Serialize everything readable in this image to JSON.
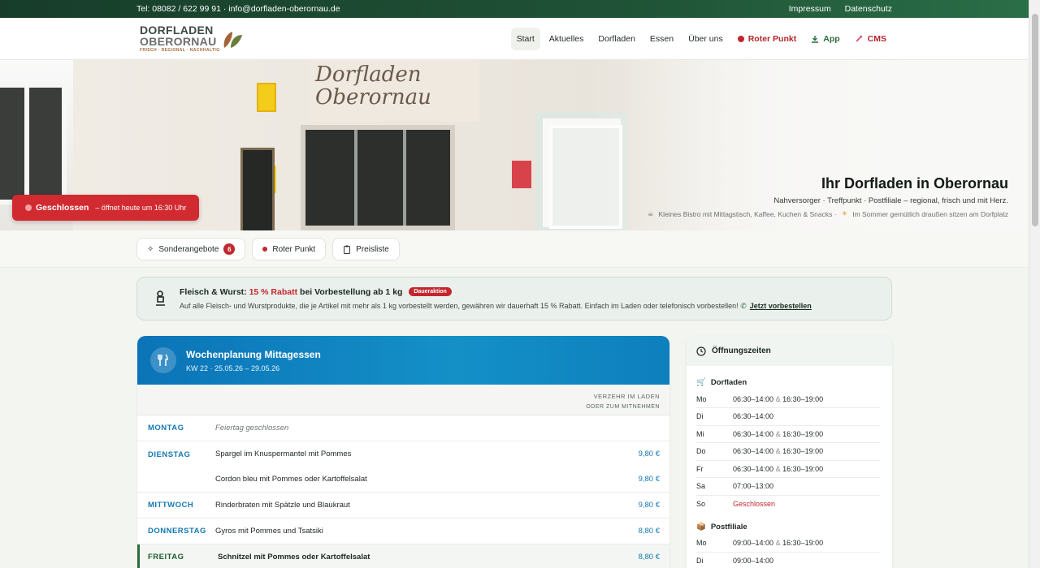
{
  "topbar": {
    "contact": "Tel: 08082 / 622 99 91 · info@dorfladen-oberornau.de",
    "links": [
      "Impressum",
      "Datenschutz"
    ]
  },
  "logo": {
    "line1": "DORFLADEN",
    "line2": "OBERORNAU",
    "tagline": "FRISCH · REGIONAL · NACHHALTIG"
  },
  "nav": {
    "items": [
      "Start",
      "Aktuelles",
      "Dorfladen",
      "Essen",
      "Über uns"
    ],
    "roter_punkt": "Roter Punkt",
    "app": "App",
    "cms": "CMS"
  },
  "hero": {
    "sign": "Dorfladen Oberornau",
    "title": "Ihr Dorfladen in Oberornau",
    "subtitle": "Nahversorger · Treffpunkt · Postfiliale – regional, frisch und mit Herz.",
    "note1": "Kleines Bistro mit Mittagstisch, Kaffee, Kuchen & Snacks ·",
    "note2": "Im Sommer gemütlich draußen sitzen am Dorfplatz",
    "status_label": "Geschlossen",
    "status_detail": "– öffnet heute um 16:30 Uhr"
  },
  "chips": {
    "sonderangebote": "Sonderangebote",
    "sonderangebote_count": "6",
    "roter_punkt": "Roter Punkt",
    "preisliste": "Preisliste"
  },
  "promo": {
    "prefix": "Fleisch & Wurst:",
    "highlight": "15 % Rabatt",
    "suffix": "bei Vorbestellung ab 1 kg",
    "tag": "Daueraktion",
    "text": "Auf alle Fleisch- und Wurstprodukte, die je Artikel mit mehr als 1 kg vorbestellt werden, gewähren wir dauerhaft 15 % Rabatt. Einfach im Laden oder telefonisch vorbestellen!",
    "cta": "Jetzt vorbestellen"
  },
  "menu": {
    "title": "Wochenplanung Mittagessen",
    "week": "KW 22 · 25.05.26 – 29.05.26",
    "sub1": "VERZEHR IM LADEN",
    "sub2": "ODER ZUM MITNEHMEN",
    "days": [
      {
        "day": "MONTAG",
        "holiday": "Feiertag geschlossen"
      },
      {
        "day": "DIENSTAG",
        "dishes": [
          {
            "name": "Spargel im Knuspermantel mit Pommes",
            "price": "9,80 €"
          },
          {
            "name": "Cordon bleu mit Pommes oder Kartoffelsalat",
            "price": "9,80 €"
          }
        ]
      },
      {
        "day": "MITTWOCH",
        "dishes": [
          {
            "name": "Rinderbraten mit Spätzle und Blaukraut",
            "price": "9,80 €"
          }
        ]
      },
      {
        "day": "DONNERSTAG",
        "dishes": [
          {
            "name": "Gyros mit Pommes und Tsatsiki",
            "price": "8,80 €"
          }
        ]
      },
      {
        "day": "FREITAG",
        "dishes": [
          {
            "name": "Schnitzel mit Pommes oder Kartoffelsalat",
            "price": "8,80 €"
          }
        ]
      }
    ]
  },
  "hours": {
    "title": "Öffnungszeiten",
    "dorfladen_title": "Dorfladen",
    "dorfladen": [
      {
        "d": "Mo",
        "a": "06:30–14:00",
        "b": "16:30–19:00"
      },
      {
        "d": "Di",
        "a": "06:30–14:00",
        "b": ""
      },
      {
        "d": "Mi",
        "a": "06:30–14:00",
        "b": "16:30–19:00"
      },
      {
        "d": "Do",
        "a": "06:30–14:00",
        "b": "16:30–19:00"
      },
      {
        "d": "Fr",
        "a": "06:30–14:00",
        "b": "16:30–19:00"
      },
      {
        "d": "Sa",
        "a": "07:00–13:00",
        "b": ""
      },
      {
        "d": "So",
        "a": "Geschlossen",
        "b": ""
      }
    ],
    "post_title": "Postfiliale",
    "post": [
      {
        "d": "Mo",
        "a": "09:00–14:00",
        "b": "16:30–19:00"
      },
      {
        "d": "Di",
        "a": "09:00–14:00",
        "b": ""
      }
    ]
  },
  "colors": {
    "brand_green": "#1f5236",
    "accent_red": "#c3262e",
    "menu_blue": "#0b74b8"
  }
}
